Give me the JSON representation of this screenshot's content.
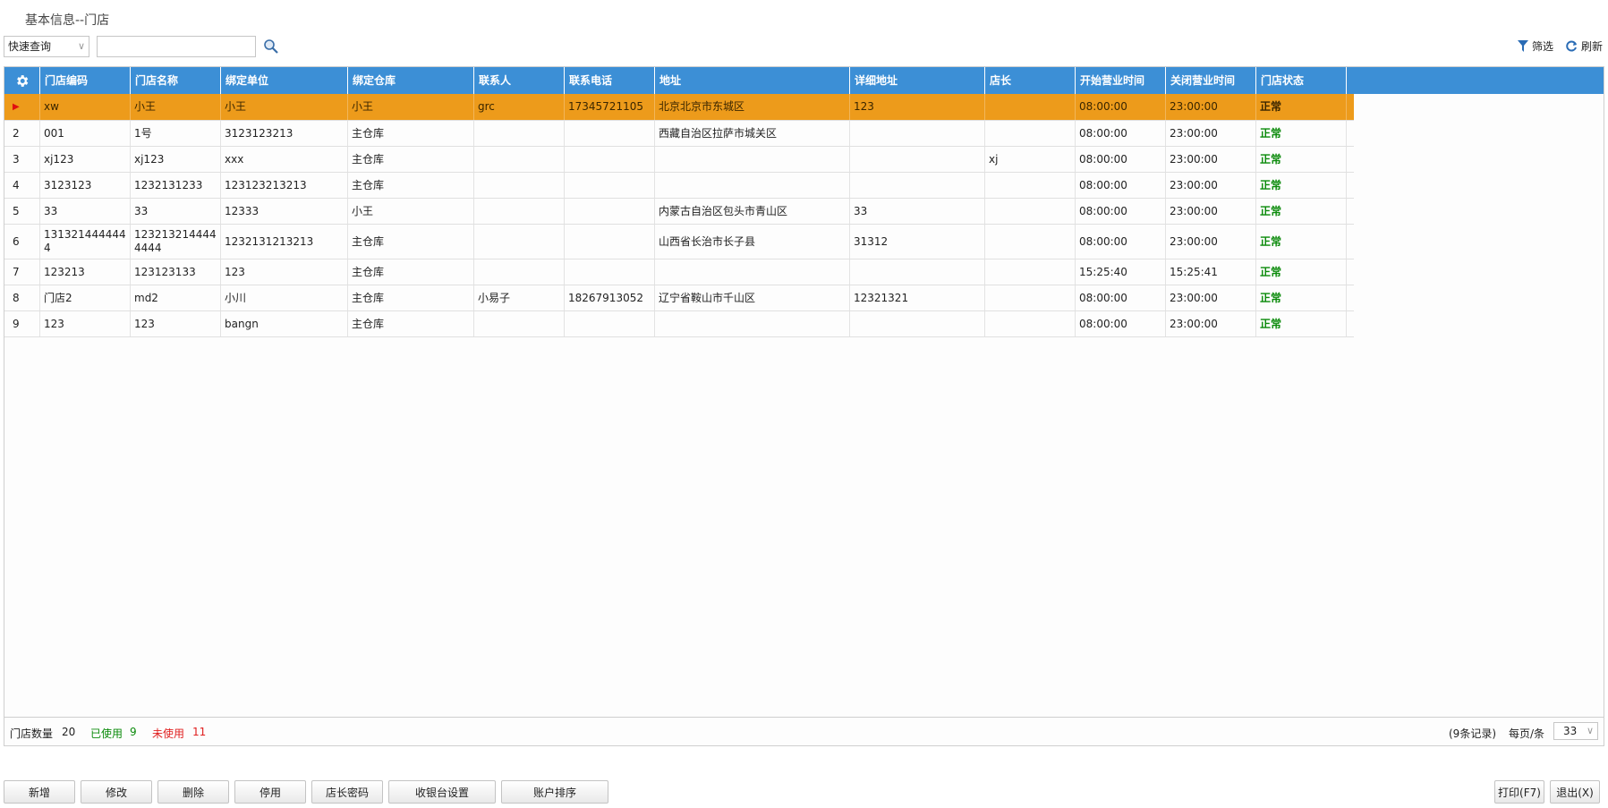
{
  "page": {
    "title": "基本信息--门店"
  },
  "toolbar": {
    "query_mode": "快速查询",
    "search_value": "",
    "filter_label": "筛选",
    "refresh_label": "刷新"
  },
  "table": {
    "columns": [
      "门店编码",
      "门店名称",
      "绑定单位",
      "绑定仓库",
      "联系人",
      "联系电话",
      "地址",
      "详细地址",
      "店长",
      "开始营业时间",
      "关闭营业时间",
      "门店状态"
    ],
    "rows": [
      {
        "rn": "",
        "code": "xw",
        "name": "小王",
        "unit": "小王",
        "warehouse": "小王",
        "contact": "grc",
        "phone": "17345721105",
        "address": "北京北京市东城区",
        "detail": "123",
        "manager": "",
        "open": "08:00:00",
        "close": "23:00:00",
        "status": "正常"
      },
      {
        "rn": "2",
        "code": "001",
        "name": "1号",
        "unit": "3123123213",
        "warehouse": "主仓库",
        "contact": "",
        "phone": "",
        "address": "西藏自治区拉萨市城关区",
        "detail": "",
        "manager": "",
        "open": "08:00:00",
        "close": "23:00:00",
        "status": "正常"
      },
      {
        "rn": "3",
        "code": "xj123",
        "name": "xj123",
        "unit": "xxx",
        "warehouse": "主仓库",
        "contact": "",
        "phone": "",
        "address": "",
        "detail": "",
        "manager": "xj",
        "open": "08:00:00",
        "close": "23:00:00",
        "status": "正常"
      },
      {
        "rn": "4",
        "code": "3123123",
        "name": "1232131233",
        "unit": "123123213213",
        "warehouse": "主仓库",
        "contact": "",
        "phone": "",
        "address": "",
        "detail": "",
        "manager": "",
        "open": "08:00:00",
        "close": "23:00:00",
        "status": "正常"
      },
      {
        "rn": "5",
        "code": "33",
        "name": "33",
        "unit": "12333",
        "warehouse": "小王",
        "contact": "",
        "phone": "",
        "address": "内蒙古自治区包头市青山区",
        "detail": "33",
        "manager": "",
        "open": "08:00:00",
        "close": "23:00:00",
        "status": "正常"
      },
      {
        "rn": "6",
        "code": "1313214444444",
        "name": "1232132144444444",
        "unit": "1232131213213",
        "warehouse": "主仓库",
        "contact": "",
        "phone": "",
        "address": "山西省长治市长子县",
        "detail": "31312",
        "manager": "",
        "open": "08:00:00",
        "close": "23:00:00",
        "status": "正常"
      },
      {
        "rn": "7",
        "code": "123213",
        "name": "123123133",
        "unit": "123",
        "warehouse": "主仓库",
        "contact": "",
        "phone": "",
        "address": "",
        "detail": "",
        "manager": "",
        "open": "15:25:40",
        "close": "15:25:41",
        "status": "正常"
      },
      {
        "rn": "8",
        "code": "门店2",
        "name": "md2",
        "unit": "小川",
        "warehouse": "主仓库",
        "contact": "小易子",
        "phone": "18267913052",
        "address": "辽宁省鞍山市千山区",
        "detail": "12321321",
        "manager": "",
        "open": "08:00:00",
        "close": "23:00:00",
        "status": "正常"
      },
      {
        "rn": "9",
        "code": "123",
        "name": "123",
        "unit": "bangn",
        "warehouse": "主仓库",
        "contact": "",
        "phone": "",
        "address": "",
        "detail": "",
        "manager": "",
        "open": "08:00:00",
        "close": "23:00:00",
        "status": "正常"
      }
    ]
  },
  "summary": {
    "store_count_label": "门店数量",
    "store_count": "20",
    "used_label": "已使用",
    "used_count": "9",
    "unused_label": "未使用",
    "unused_count": "11",
    "records_text": "(9条记录)",
    "per_page_label": "每页/条",
    "per_page_value": "33"
  },
  "buttons": {
    "add": "新增",
    "edit": "修改",
    "delete": "删除",
    "disable": "停用",
    "manager_pwd": "店长密码",
    "cashier_settings": "收银台设置",
    "account_sort": "账户排序",
    "print": "打印(F7)",
    "exit": "退出(X)"
  },
  "colors": {
    "header_bg": "#3c8fd6",
    "selected_row_bg": "#ed9b1b",
    "status_green": "#0a8a0a",
    "unused_red": "#e02020"
  }
}
